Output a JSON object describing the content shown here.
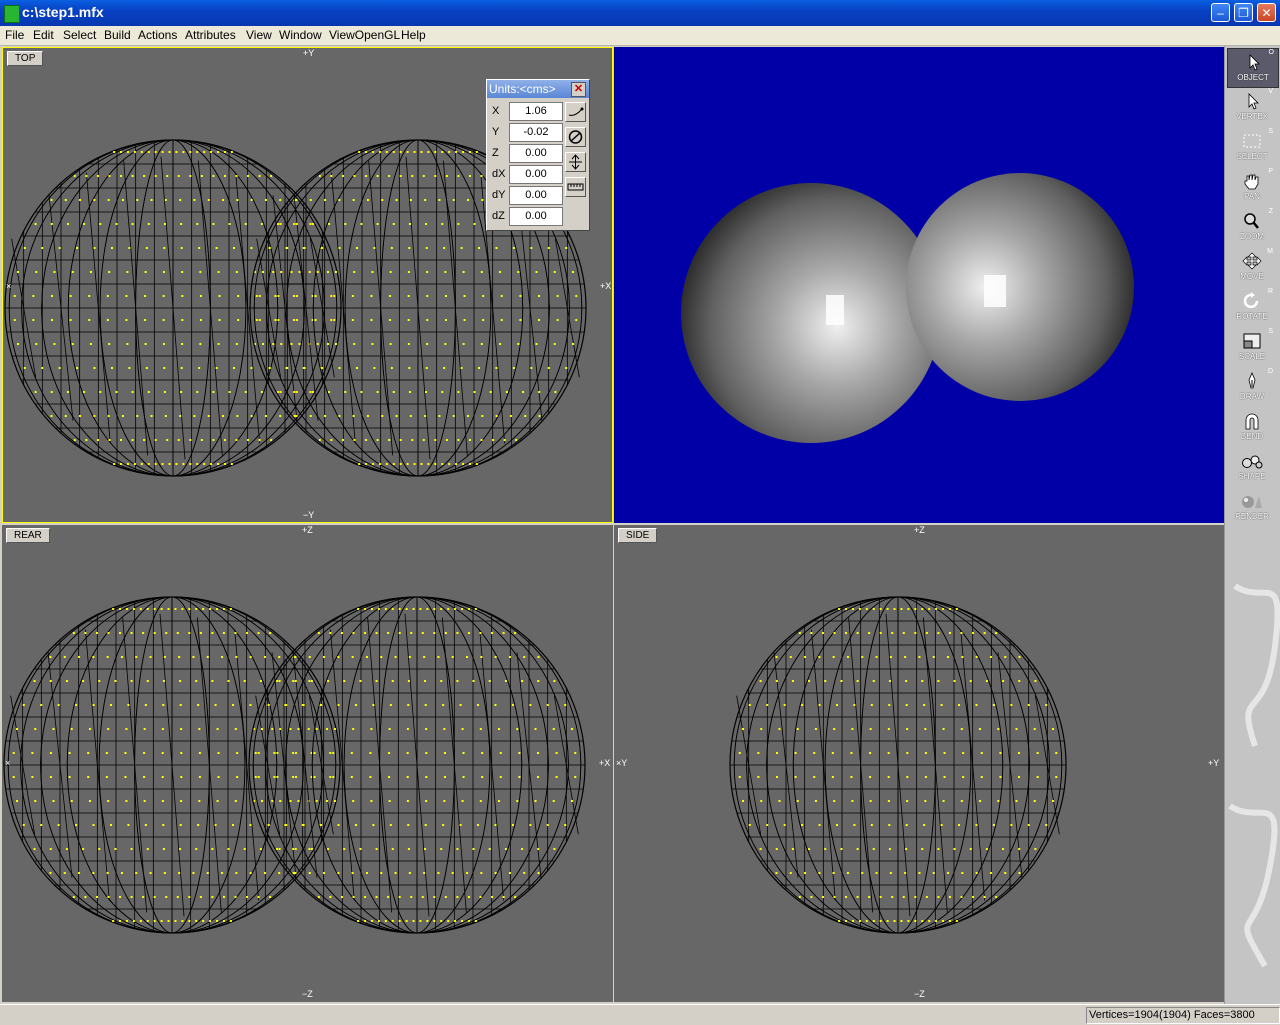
{
  "window": {
    "title": "c:\\step1.mfx"
  },
  "menu": [
    "File",
    "Edit",
    "Select",
    "Build",
    "Actions",
    "Attributes",
    "View",
    "Window",
    "ViewOpenGL",
    "Help"
  ],
  "viewports": {
    "top": {
      "label": "TOP",
      "axis_top": "+Y",
      "axis_bottom": "−Y",
      "axis_left": "×",
      "axis_right": "+X"
    },
    "rear": {
      "label": "REAR",
      "axis_top": "+Z",
      "axis_bottom": "−Z",
      "axis_left": "×",
      "axis_right": "+X"
    },
    "side": {
      "label": "SIDE",
      "axis_top": "+Z",
      "axis_bottom": "−Z",
      "axis_left": "×Y",
      "axis_right": "+Y"
    }
  },
  "units_panel": {
    "title": "Units:<cms>",
    "rows": [
      {
        "label": "X",
        "value": "1.06"
      },
      {
        "label": "Y",
        "value": "-0.02"
      },
      {
        "label": "Z",
        "value": "0.00"
      },
      {
        "label": "dX",
        "value": "0.00"
      },
      {
        "label": "dY",
        "value": "0.00"
      },
      {
        "label": "dZ",
        "value": "0.00"
      }
    ]
  },
  "tools": [
    {
      "label": "OBJECT",
      "key": "O",
      "icon": "cursor-icon"
    },
    {
      "label": "VERTEX",
      "key": "V",
      "icon": "vertex-cursor-icon"
    },
    {
      "label": "SELECT",
      "key": "S",
      "icon": "select-box-icon"
    },
    {
      "label": "PAN",
      "key": "P",
      "icon": "hand-icon"
    },
    {
      "label": "ZOOM",
      "key": "Z",
      "icon": "magnifier-icon"
    },
    {
      "label": "MOVE",
      "key": "M",
      "icon": "move-arrows-icon"
    },
    {
      "label": "ROTATE",
      "key": "R",
      "icon": "rotate-icon"
    },
    {
      "label": "SCALE",
      "key": "S",
      "icon": "scale-icon"
    },
    {
      "label": "DRAW",
      "key": "D",
      "icon": "pen-icon"
    },
    {
      "label": "BEND",
      "key": "",
      "icon": "magnet-icon"
    },
    {
      "label": "SHAPE",
      "key": "",
      "icon": "shape-spheres-icon"
    },
    {
      "label": "RENDER",
      "key": "",
      "icon": "render-spheres-icon"
    }
  ],
  "status": {
    "text": "Vertices=1904(1904) Faces=3800"
  },
  "colors": {
    "viewport_bg": "#676767",
    "perspective_bg": "#0000a6",
    "vertex": "#ffff00",
    "active_border": "#ffff00"
  }
}
